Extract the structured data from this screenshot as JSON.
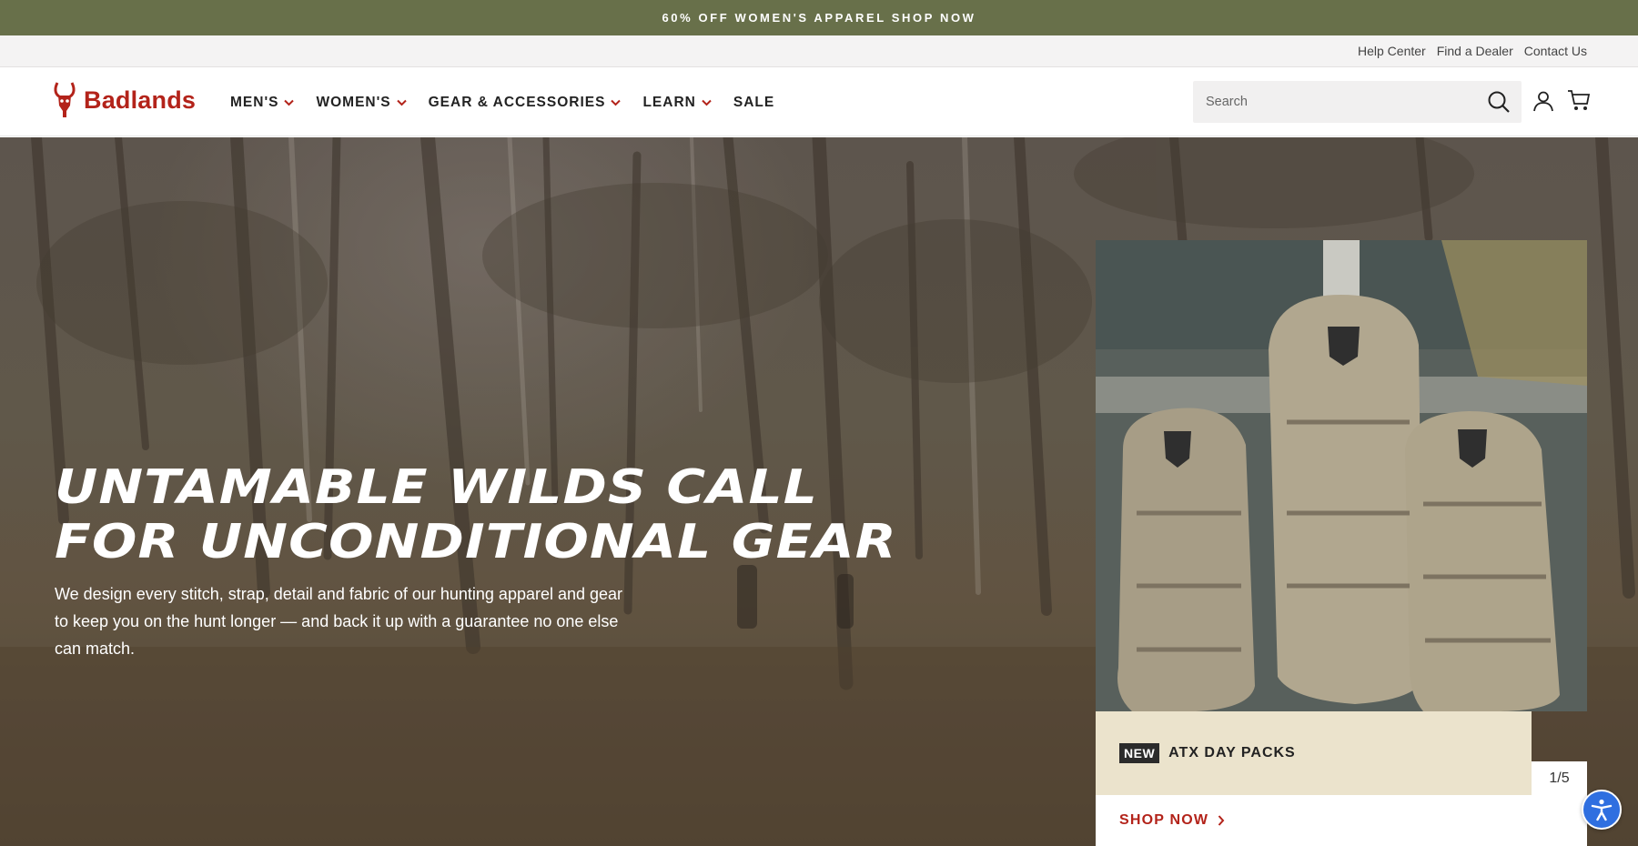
{
  "promo": {
    "text": "60% OFF WOMEN'S APPAREL SHOP NOW"
  },
  "utility_links": [
    "Help Center",
    "Find a Dealer",
    "Contact Us"
  ],
  "brand": {
    "name": "Badlands",
    "color": "#b3231a"
  },
  "nav": {
    "items": [
      {
        "label": "MEN'S",
        "has_dropdown": true
      },
      {
        "label": "WOMEN'S",
        "has_dropdown": true
      },
      {
        "label": "GEAR & ACCESSORIES",
        "has_dropdown": true
      },
      {
        "label": "LEARN",
        "has_dropdown": true
      },
      {
        "label": "SALE",
        "has_dropdown": false
      }
    ]
  },
  "search": {
    "placeholder": "Search",
    "icon": "search-icon"
  },
  "hero": {
    "headline_line1": "UNTAMABLE WILDS CALL",
    "headline_line2": "FOR UNCONDITIONAL GEAR",
    "body": "We design every stitch, strap, detail and fabric of our hunting apparel and gear to keep you on the hunt longer — and back it up with a guarantee no one else can match."
  },
  "feature_card": {
    "badge": "NEW",
    "title": "ATX DAY PACKS",
    "counter": "1/5",
    "cta": "SHOP NOW"
  },
  "colors": {
    "promo_bg": "#68704a",
    "accent": "#b3231a",
    "caption_bg": "#ebe3cc",
    "a11y": "#2f6fe0"
  }
}
